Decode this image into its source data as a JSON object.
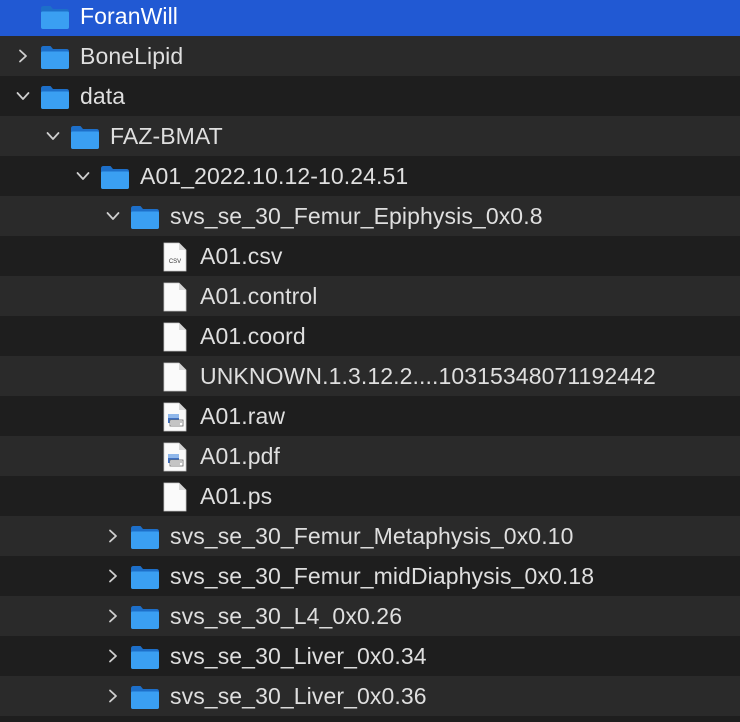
{
  "tree": {
    "rows": [
      {
        "name": "ForanWill",
        "type": "folder",
        "depth": 0,
        "chevron": "none",
        "selected": true
      },
      {
        "name": "BoneLipid",
        "type": "folder",
        "depth": 0,
        "chevron": "right"
      },
      {
        "name": "data",
        "type": "folder",
        "depth": 0,
        "chevron": "down"
      },
      {
        "name": "FAZ-BMAT",
        "type": "folder",
        "depth": 1,
        "chevron": "down"
      },
      {
        "name": "A01_2022.10.12-10.24.51",
        "type": "folder",
        "depth": 2,
        "chevron": "down"
      },
      {
        "name": "svs_se_30_Femur_Epiphysis_0x0.8",
        "type": "folder",
        "depth": 3,
        "chevron": "down"
      },
      {
        "name": "A01.csv",
        "type": "csv",
        "icon_text": "CSV",
        "depth": 4,
        "chevron": "none"
      },
      {
        "name": "A01.control",
        "type": "file",
        "depth": 4,
        "chevron": "none"
      },
      {
        "name": "A01.coord",
        "type": "file",
        "depth": 4,
        "chevron": "none"
      },
      {
        "name": "UNKNOWN.1.3.12.2....10315348071192442",
        "type": "file",
        "depth": 4,
        "chevron": "none"
      },
      {
        "name": "A01.raw",
        "type": "preview",
        "depth": 4,
        "chevron": "none"
      },
      {
        "name": "A01.pdf",
        "type": "preview",
        "depth": 4,
        "chevron": "none"
      },
      {
        "name": "A01.ps",
        "type": "file",
        "depth": 4,
        "chevron": "none"
      },
      {
        "name": "svs_se_30_Femur_Metaphysis_0x0.10",
        "type": "folder",
        "depth": 3,
        "chevron": "right"
      },
      {
        "name": "svs_se_30_Femur_midDiaphysis_0x0.18",
        "type": "folder",
        "depth": 3,
        "chevron": "right"
      },
      {
        "name": "svs_se_30_L4_0x0.26",
        "type": "folder",
        "depth": 3,
        "chevron": "right"
      },
      {
        "name": "svs_se_30_Liver_0x0.34",
        "type": "folder",
        "depth": 3,
        "chevron": "right"
      },
      {
        "name": "svs_se_30_Liver_0x0.36",
        "type": "folder",
        "depth": 3,
        "chevron": "right"
      }
    ]
  },
  "colors": {
    "selection": "#2159d3",
    "row_dark": "#1e1e1e",
    "row_light": "#2a2a2a",
    "text": "#dfdfdf",
    "folder_front": "#3a9ff2",
    "folder_back": "#1d6fc9"
  },
  "icons": {
    "folder": "folder-icon",
    "file": "file-icon",
    "csv": "csv-file-icon",
    "preview": "preview-document-icon",
    "expand": "chevron-right-icon",
    "collapse": "chevron-down-icon"
  }
}
